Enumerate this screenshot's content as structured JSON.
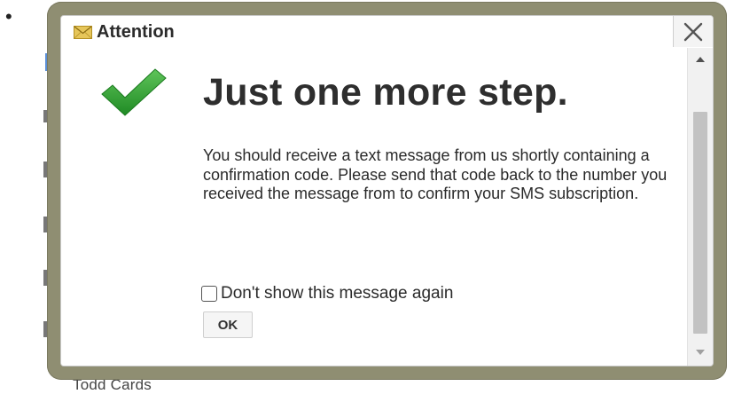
{
  "background": {
    "bullet": "•",
    "bottom_text": "Todd Cards"
  },
  "dialog": {
    "title": "Attention",
    "title_icon": "envelope-icon",
    "close_glyph": "✕",
    "heading": "Just one more step.",
    "heading_icon": "checkmark-icon",
    "message": "You should receive a text message from us shortly containing a confirmation code. Please send that code back to the number you received the message from to confirm your SMS subscription.",
    "checkbox": {
      "label": "Don't show this message again",
      "checked": false
    },
    "ok_label": "OK"
  },
  "colors": {
    "frame": "#8f8e72",
    "check_green": "#2e9c2e",
    "envelope": "#e6c65a"
  }
}
